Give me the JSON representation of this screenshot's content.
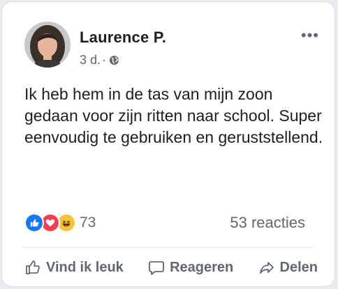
{
  "post": {
    "author": "Laurence P.",
    "time": "3 d.",
    "separator": "·",
    "more_icon": "more-horizontal-icon",
    "text": "Ik heb hem in de tas van mijn zoon gedaan voor zijn ritten naar school. Super eenvoudig te gebruiken en geruststellend."
  },
  "reactions": {
    "icons": [
      "like-reaction-icon",
      "love-reaction-icon",
      "haha-reaction-icon"
    ],
    "count": "73",
    "summary": "53 reacties"
  },
  "actions": {
    "like_label": "Vind ik leuk",
    "comment_label": "Reageren",
    "share_label": "Delen"
  },
  "colors": {
    "text": "#1c1e21",
    "secondary": "#65676b",
    "like_blue": "#1877f2",
    "love_red": "#f33e58",
    "haha_yellow": "#f7c33d"
  }
}
